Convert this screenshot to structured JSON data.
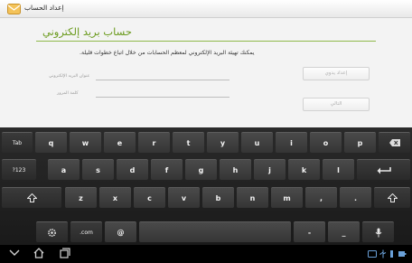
{
  "titlebar": {
    "title": "إعداد الحساب"
  },
  "main": {
    "heading": "حساب بريد إلكتروني",
    "description": "يمكنك تهيئة البريد الإلكتروني لمعظم الحسابات من خلال اتباع خطوات قليلة.",
    "email_label": "عنوان البريد الإلكتروني",
    "password_label": "كلمة المرور",
    "manual_setup_button": "إعداد يدوي",
    "next_button": "التالي"
  },
  "keyboard": {
    "row1": [
      "Tab",
      "q",
      "w",
      "e",
      "r",
      "t",
      "y",
      "u",
      "i",
      "o",
      "p"
    ],
    "row2": [
      "?123",
      "a",
      "s",
      "d",
      "f",
      "g",
      "h",
      "j",
      "k",
      "l"
    ],
    "row3": [
      "z",
      "x",
      "c",
      "v",
      "b",
      "n",
      "m",
      ",",
      "."
    ],
    "row4": {
      "dotcom": ".com",
      "at": "@",
      "dash": "-",
      "underscore": "_"
    }
  },
  "colors": {
    "accent": "#6a9a1c",
    "keyboard_bg": "#1e1e1e",
    "key_bg": "#404040",
    "status_blue": "#6aa0d8"
  },
  "icons": {
    "app": "email-envelope-icon",
    "backspace": "backspace-icon",
    "enter": "enter-arrow-icon",
    "shift": "shift-arrow-icon",
    "settings": "gear-icon",
    "mic": "microphone-icon",
    "back": "back-chevron-icon",
    "home": "home-icon",
    "recent": "recent-apps-icon"
  }
}
